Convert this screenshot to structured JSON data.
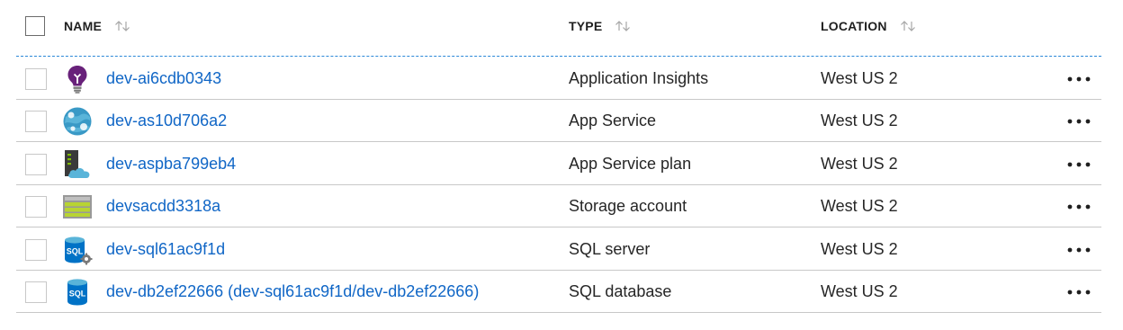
{
  "header": {
    "name_label": "NAME",
    "type_label": "TYPE",
    "location_label": "LOCATION"
  },
  "rows": [
    {
      "name": "dev-ai6cdb0343",
      "type": "Application Insights",
      "location": "West US 2",
      "icon": "lightbulb-icon"
    },
    {
      "name": "dev-as10d706a2",
      "type": "App Service",
      "location": "West US 2",
      "icon": "app-service-globe-icon"
    },
    {
      "name": "dev-aspba799eb4",
      "type": "App Service plan",
      "location": "West US 2",
      "icon": "server-cloud-icon"
    },
    {
      "name": "devsacdd3318a",
      "type": "Storage account",
      "location": "West US 2",
      "icon": "storage-account-icon"
    },
    {
      "name": "dev-sql61ac9f1d",
      "type": "SQL server",
      "location": "West US 2",
      "icon": "sql-server-icon"
    },
    {
      "name": "dev-db2ef22666 (dev-sql61ac9f1d/dev-db2ef22666)",
      "type": "SQL database",
      "location": "West US 2",
      "icon": "sql-database-icon"
    }
  ],
  "icon_text": {
    "sql": "SQL"
  },
  "colors": {
    "link": "#1066c6",
    "header_divider": "#2b88d8",
    "row_divider": "#c8c8c8",
    "insights_purple": "#68217a",
    "app_service_blue": "#3999c6",
    "storage_green": "#b8d432",
    "sql_blue": "#0072c6"
  }
}
